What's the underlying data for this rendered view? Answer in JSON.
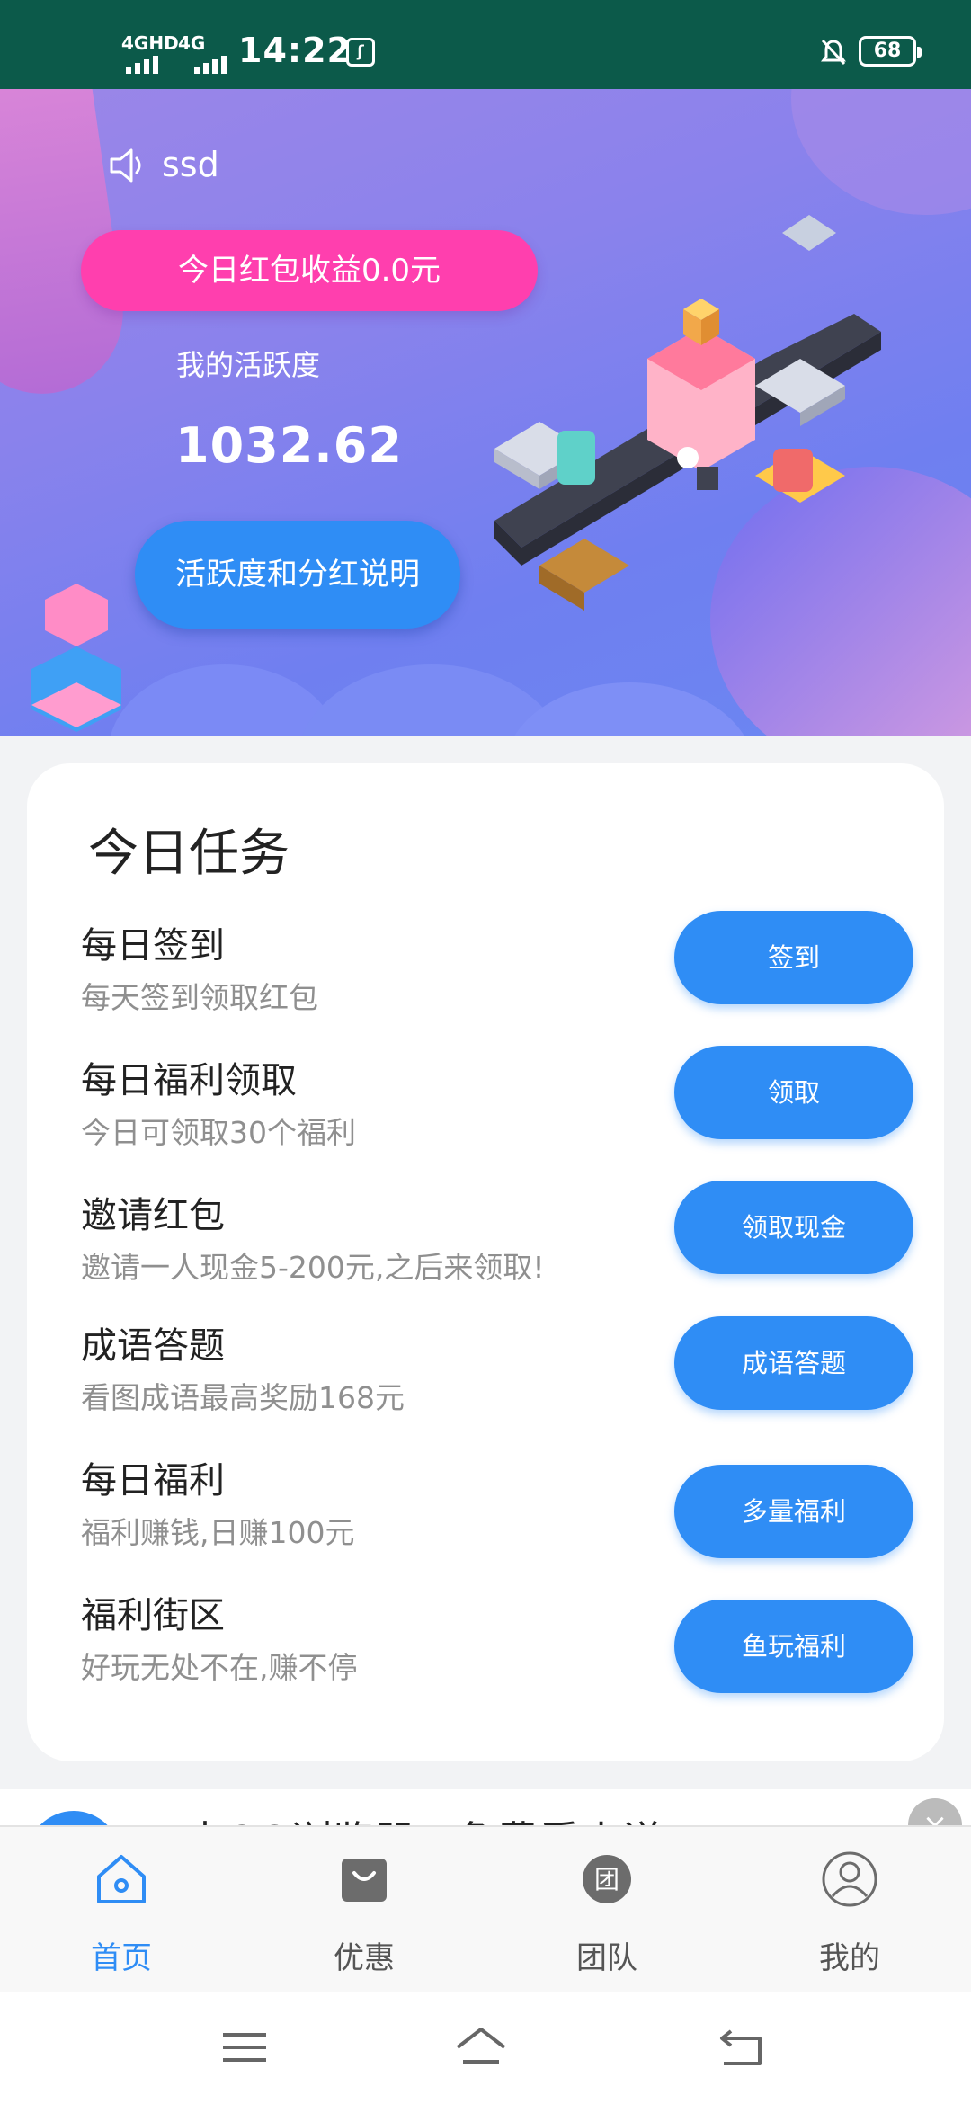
{
  "status_bar": {
    "signal1": "4GHD",
    "signal2": "4G",
    "time": "14:22",
    "app_icon": "poo",
    "battery": "68"
  },
  "hero": {
    "username": "ssd",
    "today_earnings": "今日红包收益0.0元",
    "activity_label": "我的活跃度",
    "activity_value": "1032.62",
    "explain_button": "活跃度和分红说明"
  },
  "tasks": {
    "title": "今日任务",
    "items": [
      {
        "name": "每日签到",
        "desc": "每天签到领取红包",
        "button": "签到"
      },
      {
        "name": "每日福利领取",
        "desc": "今日可领取30个福利",
        "button": "领取"
      },
      {
        "name": "邀请红包",
        "desc": "邀请一人现金5-200元,之后来领取!",
        "button": "领取现金"
      },
      {
        "name": "成语答题",
        "desc": "看图成语最高奖励168元",
        "button": "成语答题"
      },
      {
        "name": "每日福利",
        "desc": "福利赚钱,日赚100元",
        "button": "多量福利"
      },
      {
        "name": "福利街区",
        "desc": "好玩无处不在,赚不停",
        "button": "鱼玩福利"
      }
    ]
  },
  "promo": {
    "text": "来QQ浏览器，免费看小说"
  },
  "bottom_nav": {
    "items": [
      {
        "label": "首页",
        "icon": "home-icon"
      },
      {
        "label": "优惠",
        "icon": "shopping-bag-icon"
      },
      {
        "label": "团队",
        "icon": "team-icon"
      },
      {
        "label": "我的",
        "icon": "profile-icon"
      }
    ],
    "active_index": 0
  },
  "system_nav": {
    "icons": [
      "menu-icon",
      "home-icon",
      "back-icon"
    ]
  },
  "colors": {
    "accent": "#2f8df5",
    "pink": "#ff3fae",
    "status_bar": "#0c5a4a"
  }
}
